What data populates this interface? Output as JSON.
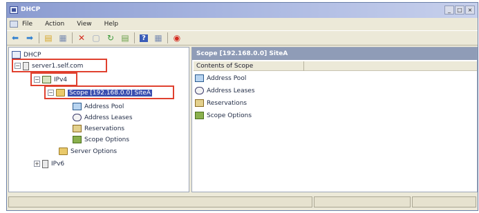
{
  "window": {
    "title": "DHCP"
  },
  "window_buttons": [
    "_",
    "□",
    "×"
  ],
  "menu": [
    "File",
    "Action",
    "View",
    "Help"
  ],
  "toolbar": [
    {
      "icon": "back-arrow-icon",
      "glyph": "⬅",
      "color": "#2e7fd0"
    },
    {
      "icon": "forward-arrow-icon",
      "glyph": "➡",
      "color": "#2e7fd0"
    },
    {
      "sep": true
    },
    {
      "icon": "up-folder-icon",
      "glyph": "▤",
      "color": "#d6a62a"
    },
    {
      "icon": "show-hide-tree-icon",
      "glyph": "▦",
      "color": "#7b8db2"
    },
    {
      "sep": true
    },
    {
      "icon": "delete-icon",
      "glyph": "✕",
      "color": "#d42a1e"
    },
    {
      "icon": "properties-icon",
      "glyph": "▢",
      "color": "#9aa6be"
    },
    {
      "icon": "refresh-icon",
      "glyph": "↻",
      "color": "#3a9a3a"
    },
    {
      "icon": "export-list-icon",
      "glyph": "▤",
      "color": "#6aa04a"
    },
    {
      "sep": true
    },
    {
      "icon": "help-icon",
      "glyph": "?",
      "color": "#ffffff",
      "bg": "#3a5cb8"
    },
    {
      "icon": "console-icon",
      "glyph": "▦",
      "color": "#7b8db2"
    },
    {
      "sep": true
    },
    {
      "icon": "stop-icon",
      "glyph": "◉",
      "color": "#d42a1e"
    }
  ],
  "tree": {
    "root": "DHCP",
    "server": "server1.self.com",
    "ipv4": "IPv4",
    "scope": "Scope [192.168.0.0] SiteA",
    "children": [
      "Address Pool",
      "Address Leases",
      "Reservations",
      "Scope Options"
    ],
    "server_options": "Server Options",
    "ipv6": "IPv6"
  },
  "right_pane": {
    "title": "Scope [192.168.0.0] SiteA",
    "column": "Contents of Scope",
    "items": [
      "Address Pool",
      "Address Leases",
      "Reservations",
      "Scope Options"
    ]
  },
  "expanders": {
    "collapsed": "+",
    "expanded": "−"
  }
}
